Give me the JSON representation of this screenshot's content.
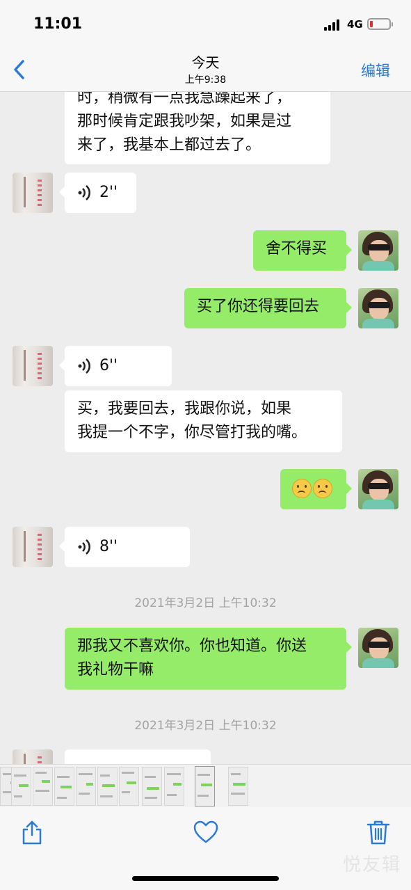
{
  "status_bar": {
    "time": "11:01",
    "network": "4G",
    "battery_level": 0.1,
    "battery_color": "#e0312f"
  },
  "nav": {
    "back_icon": "chevron-left-icon",
    "title": "今天",
    "subtitle": "上午9:38",
    "edit_label": "编辑",
    "accent": "#2b7ad6"
  },
  "messages": [
    {
      "from": "other",
      "type": "text",
      "lines": [
        "时，稍微有一点我急躁起来了，",
        "那时候肯定跟我吵架，如果是过",
        "来了，我基本上都过去了。"
      ]
    },
    {
      "from": "other",
      "type": "voice",
      "duration": "2''"
    },
    {
      "from": "self",
      "type": "text",
      "text": "舍不得买"
    },
    {
      "from": "self",
      "type": "text",
      "text": "买了你还得要回去"
    },
    {
      "from": "other",
      "type": "voice",
      "duration": "6''"
    },
    {
      "from": "other",
      "type": "text",
      "lines": [
        "买，我要回去，我跟你说，如果",
        "我提一个不字，你尽管打我的嘴。"
      ]
    },
    {
      "from": "self",
      "type": "emoji",
      "icons": [
        "sad-face-icon",
        "sad-face-icon"
      ]
    },
    {
      "from": "other",
      "type": "voice",
      "duration": "8''"
    },
    {
      "from": "system",
      "type": "timestamp",
      "text": "2021年3月2日 上午10:32"
    },
    {
      "from": "self",
      "type": "text",
      "lines": [
        "那我又不喜欢你。你也知道。你送",
        "我礼物干嘛"
      ]
    },
    {
      "from": "system",
      "type": "timestamp",
      "text": "2021年3月2日 上午10:32"
    }
  ],
  "colors": {
    "self_bubble": "#95ec69",
    "other_bubble": "#ffffff",
    "chat_bg": "#ededed"
  },
  "toolbar": {
    "share_icon": "share-icon",
    "like_icon": "heart-icon",
    "delete_icon": "trash-icon"
  },
  "watermark": "悦友辑"
}
